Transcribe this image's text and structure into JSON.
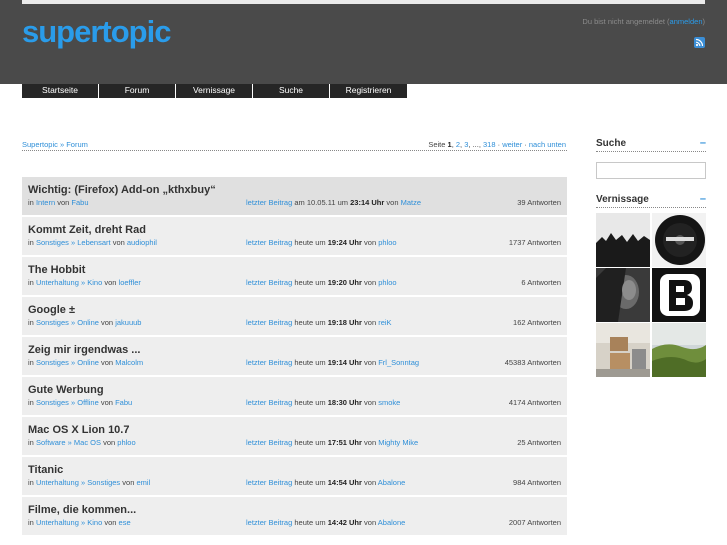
{
  "brand": {
    "logo": "supertopic"
  },
  "login": {
    "text": "Du bist nicht angemeldet (",
    "link": "anmelden",
    "close": ")"
  },
  "nav": [
    {
      "label": "Startseite"
    },
    {
      "label": "Forum"
    },
    {
      "label": "Vernissage"
    },
    {
      "label": "Suche"
    },
    {
      "label": "Registrieren"
    }
  ],
  "breadcrumb": {
    "home": "Supertopic",
    "sep": " » ",
    "current": "Forum"
  },
  "pager": {
    "prefix": "Seite ",
    "current": "1",
    "p2": "2",
    "p3": "3",
    "ellipsis": "...",
    "last": "318",
    "next": "weiter",
    "down": "nach unten"
  },
  "threads": [
    {
      "title": "Wichtig: (Firefox) Add-on „kthxbuy“",
      "cat1": "Intern",
      "cat2": "",
      "author": "Fabu",
      "last_label": "letzter Beitrag",
      "day": "am 10.05.11 um",
      "time": "23:14 Uhr",
      "by": "Matze",
      "answers": "39 Antworten"
    },
    {
      "title": "Kommt Zeit, dreht Rad",
      "cat1": "Sonstiges",
      "cat2": "Lebensart",
      "author": "audiophil",
      "last_label": "letzter Beitrag",
      "day": "heute um",
      "time": "19:24 Uhr",
      "by": "phloo",
      "answers": "1737 Antworten"
    },
    {
      "title": "The Hobbit",
      "cat1": "Unterhaltung",
      "cat2": "Kino",
      "author": "loeffler",
      "last_label": "letzter Beitrag",
      "day": "heute um",
      "time": "19:20 Uhr",
      "by": "phloo",
      "answers": "6 Antworten"
    },
    {
      "title": "Google ±",
      "cat1": "Sonstiges",
      "cat2": "Online",
      "author": "jakuuub",
      "last_label": "letzter Beitrag",
      "day": "heute um",
      "time": "19:18 Uhr",
      "by": "reiK",
      "answers": "162 Antworten"
    },
    {
      "title": "Zeig mir irgendwas ...",
      "cat1": "Sonstiges",
      "cat2": "Online",
      "author": "Malcolm",
      "last_label": "letzter Beitrag",
      "day": "heute um",
      "time": "19:14 Uhr",
      "by": "Frl_Sonntag",
      "answers": "45383 Antworten"
    },
    {
      "title": "Gute Werbung",
      "cat1": "Sonstiges",
      "cat2": "Offline",
      "author": "Fabu",
      "last_label": "letzter Beitrag",
      "day": "heute um",
      "time": "18:30 Uhr",
      "by": "smoke",
      "answers": "4174 Antworten"
    },
    {
      "title": "Mac OS X Lion 10.7",
      "cat1": "Software",
      "cat2": "Mac OS",
      "author": "phloo",
      "last_label": "letzter Beitrag",
      "day": "heute um",
      "time": "17:51 Uhr",
      "by": "Mighty Mike",
      "answers": "25 Antworten"
    },
    {
      "title": "Titanic",
      "cat1": "Unterhaltung",
      "cat2": "Sonstiges",
      "author": "emil",
      "last_label": "letzter Beitrag",
      "day": "heute um",
      "time": "14:54 Uhr",
      "by": "Abalone",
      "answers": "984 Antworten"
    },
    {
      "title": "Filme, die kommen...",
      "cat1": "Unterhaltung",
      "cat2": "Kino",
      "author": "ese",
      "last_label": "letzter Beitrag",
      "day": "heute um",
      "time": "14:42 Uhr",
      "by": "Abalone",
      "answers": "2007 Antworten"
    }
  ],
  "labels": {
    "in": "in",
    "sep": "»",
    "von": "von"
  },
  "sidebar": {
    "search_title": "Suche",
    "gallery_title": "Vernissage",
    "toggle": "–"
  },
  "colors": {
    "brand": "#2a9cea",
    "link": "#2f8fd8",
    "header": "#4a4a4a",
    "nav": "#262626"
  }
}
